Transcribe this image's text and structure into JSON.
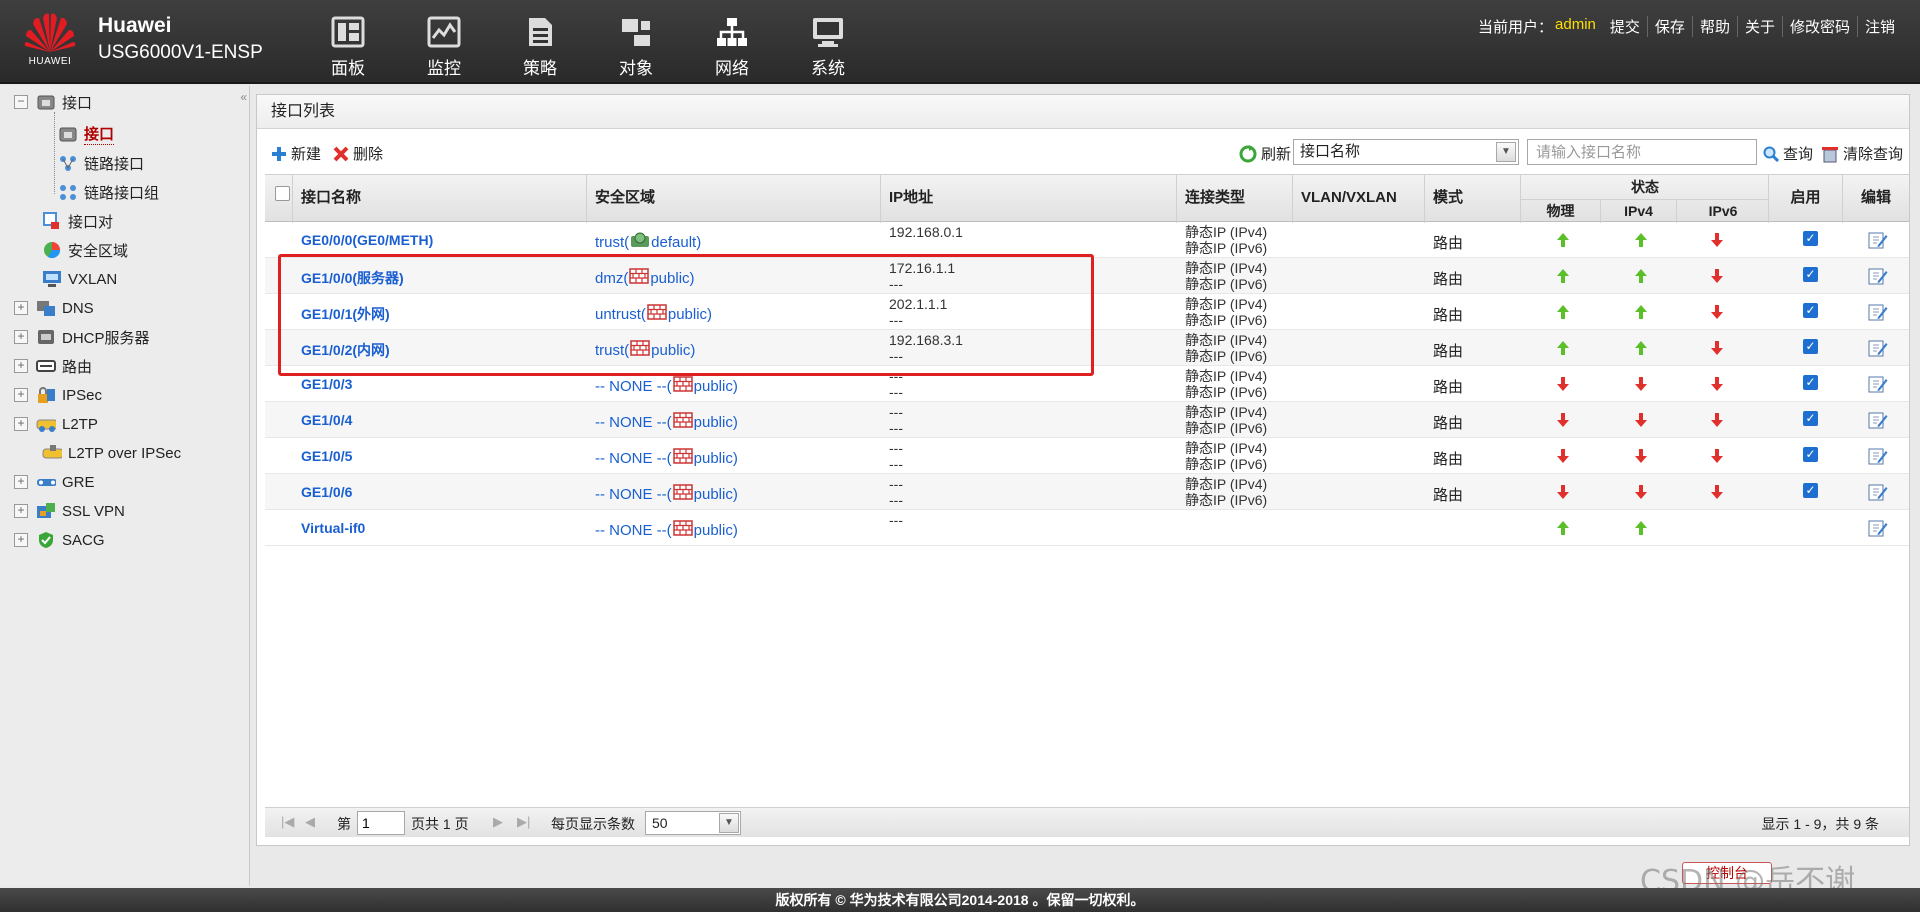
{
  "header": {
    "logo_text": "HUAWEI",
    "brand_name": "Huawei",
    "device_model": "USG6000V1-ENSP",
    "nav": [
      {
        "label": "面板",
        "icon": "dashboard-icon"
      },
      {
        "label": "监控",
        "icon": "monitor-icon"
      },
      {
        "label": "策略",
        "icon": "policy-icon"
      },
      {
        "label": "对象",
        "icon": "object-icon"
      },
      {
        "label": "网络",
        "icon": "network-icon"
      },
      {
        "label": "系统",
        "icon": "system-icon"
      }
    ],
    "current_user_label": "当前用户：",
    "current_user": "admin",
    "links": [
      "提交",
      "保存",
      "帮助",
      "关于",
      "修改密码",
      "注销"
    ]
  },
  "sidebar": {
    "items": [
      {
        "label": "接口",
        "expander": "−"
      },
      {
        "label": "接口",
        "active": true
      },
      {
        "label": "链路接口"
      },
      {
        "label": "链路接口组"
      },
      {
        "label": "接口对"
      },
      {
        "label": "安全区域"
      },
      {
        "label": "VXLAN"
      },
      {
        "label": "DNS",
        "expander": "+"
      },
      {
        "label": "DHCP服务器",
        "expander": "+"
      },
      {
        "label": "路由",
        "expander": "+"
      },
      {
        "label": "IPSec",
        "expander": "+"
      },
      {
        "label": "L2TP",
        "expander": "+"
      },
      {
        "label": "L2TP over IPSec"
      },
      {
        "label": "GRE",
        "expander": "+"
      },
      {
        "label": "SSL VPN",
        "expander": "+"
      },
      {
        "label": "SACG",
        "expander": "+"
      }
    ]
  },
  "panel": {
    "title": "接口列表",
    "toolbar": {
      "new": "新建",
      "delete": "删除",
      "refresh": "刷新",
      "filter_selected": "接口名称",
      "search_placeholder": "请输入接口名称",
      "query": "查询",
      "clear_query": "清除查询"
    },
    "columns": {
      "name": "接口名称",
      "zone": "安全区域",
      "ip": "IP地址",
      "conn_type": "连接类型",
      "vlan": "VLAN/VXLAN",
      "mode": "模式",
      "status": "状态",
      "physical": "物理",
      "ipv4": "IPv4",
      "ipv6": "IPv6",
      "enable": "启用",
      "edit": "编辑"
    },
    "rows": [
      {
        "name": "GE0/0/0(GE0/METH)",
        "zone_prefix": "trust(",
        "zone_suffix": "default)",
        "ip1": "192.168.0.1",
        "ip2": "",
        "conn1": "静态IP (IPv4)",
        "conn2": "静态IP (IPv6)",
        "mode": "路由",
        "phy": "up",
        "v4": "up",
        "v6": "down",
        "enabled": true
      },
      {
        "name": "GE1/0/0(服务器)",
        "zone_prefix": "dmz(",
        "zone_suffix": "public)",
        "ip1": "172.16.1.1",
        "ip2": "---",
        "conn1": "静态IP (IPv4)",
        "conn2": "静态IP (IPv6)",
        "mode": "路由",
        "phy": "up",
        "v4": "up",
        "v6": "down",
        "enabled": true
      },
      {
        "name": "GE1/0/1(外网)",
        "zone_prefix": "untrust(",
        "zone_suffix": "public)",
        "ip1": "202.1.1.1",
        "ip2": "---",
        "conn1": "静态IP (IPv4)",
        "conn2": "静态IP (IPv6)",
        "mode": "路由",
        "phy": "up",
        "v4": "up",
        "v6": "down",
        "enabled": true
      },
      {
        "name": "GE1/0/2(内网)",
        "zone_prefix": "trust(",
        "zone_suffix": "public)",
        "ip1": "192.168.3.1",
        "ip2": "---",
        "conn1": "静态IP (IPv4)",
        "conn2": "静态IP (IPv6)",
        "mode": "路由",
        "phy": "up",
        "v4": "up",
        "v6": "down",
        "enabled": true
      },
      {
        "name": "GE1/0/3",
        "zone_prefix": "-- NONE --(",
        "zone_suffix": "public)",
        "ip1": "---",
        "ip2": "---",
        "conn1": "静态IP (IPv4)",
        "conn2": "静态IP (IPv6)",
        "mode": "路由",
        "phy": "down",
        "v4": "down",
        "v6": "down",
        "enabled": true
      },
      {
        "name": "GE1/0/4",
        "zone_prefix": "-- NONE --(",
        "zone_suffix": "public)",
        "ip1": "---",
        "ip2": "---",
        "conn1": "静态IP (IPv4)",
        "conn2": "静态IP (IPv6)",
        "mode": "路由",
        "phy": "down",
        "v4": "down",
        "v6": "down",
        "enabled": true
      },
      {
        "name": "GE1/0/5",
        "zone_prefix": "-- NONE --(",
        "zone_suffix": "public)",
        "ip1": "---",
        "ip2": "---",
        "conn1": "静态IP (IPv4)",
        "conn2": "静态IP (IPv6)",
        "mode": "路由",
        "phy": "down",
        "v4": "down",
        "v6": "down",
        "enabled": true
      },
      {
        "name": "GE1/0/6",
        "zone_prefix": "-- NONE --(",
        "zone_suffix": "public)",
        "ip1": "---",
        "ip2": "---",
        "conn1": "静态IP (IPv4)",
        "conn2": "静态IP (IPv6)",
        "mode": "路由",
        "phy": "down",
        "v4": "down",
        "v6": "down",
        "enabled": true
      },
      {
        "name": "Virtual-if0",
        "zone_prefix": "-- NONE --(",
        "zone_suffix": "public)",
        "ip1": "---",
        "ip2": "",
        "conn1": "",
        "conn2": "",
        "mode": "",
        "phy": "up",
        "v4": "up",
        "v6": "",
        "enabled": false
      }
    ],
    "pager": {
      "page_label": "第",
      "page_value": "1",
      "total_label": "页共 1 页",
      "per_page_label": "每页显示条数",
      "per_page_value": "50",
      "summary": "显示 1 - 9，共 9 条"
    }
  },
  "footer": {
    "copyright": "版权所有 © 华为技术有限公司2014-2018 。保留一切权利。",
    "console": "控制台",
    "watermark": "CSDN @岳不谢"
  },
  "colors": {
    "link": "#1a5fd1",
    "up_arrow": "#5bbf2a",
    "down_arrow": "#e0302b",
    "highlight": "#e02020",
    "user": "#ffde00"
  }
}
